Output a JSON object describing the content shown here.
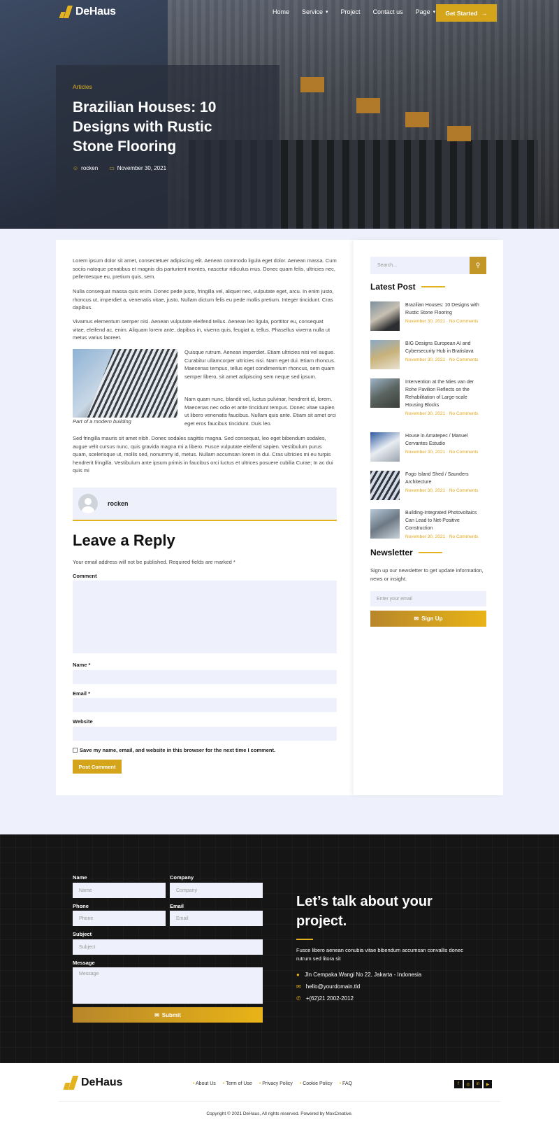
{
  "brand": {
    "name": "DeHaus",
    "accent": "#e2b21f"
  },
  "nav": {
    "items": [
      "Home",
      "Service",
      "Project",
      "Contact us",
      "Page"
    ],
    "cta": "Get Started"
  },
  "hero": {
    "category": "Articles",
    "title": "Brazilian Houses: 10 Designs with Rustic Stone Flooring",
    "author": "rocken",
    "date": "November 30, 2021"
  },
  "article": {
    "p1": "Lorem ipsum dolor sit amet, consectetuer adipiscing elit. Aenean commodo ligula eget dolor. Aenean massa. Cum sociis natoque penatibus et magnis dis parturient montes, nascetur ridiculus mus. Donec quam felis, ultricies nec, pellentesque eu, pretium quis, sem.",
    "p2": "Nulla consequat massa quis enim. Donec pede justo, fringilla vel, aliquet nec, vulputate eget, arcu. In enim justo, rhoncus ut, imperdiet a, venenatis vitae, justo. Nullam dictum felis eu pede mollis pretium. Integer tincidunt. Cras dapibus.",
    "p3": "Vivamus elementum semper nisi. Aenean vulputate eleifend tellus. Aenean leo ligula, porttitor eu, consequat vitae, eleifend ac, enim. Aliquam lorem ante, dapibus in, viverra quis, feugiat a, tellus. Phasellus viverra nulla ut metus varius laoreet.",
    "p4": "Quisque rutrum. Aenean imperdiet. Etiam ultricies nisi vel augue. Curabitur ullamcorper ultricies nisi. Nam eget dui. Etiam rhoncus. Maecenas tempus, tellus eget condimentum rhoncus, sem quam semper libero, sit amet adipiscing sem neque sed ipsum.",
    "p5": "Nam quam nunc, blandit vel, luctus pulvinar, hendrerit id, lorem. Maecenas nec odio et ante tincidunt tempus. Donec vitae sapien ut libero venenatis faucibus. Nullam quis ante. Etiam sit amet orci eget eros faucibus tincidunt. Duis leo.",
    "p6": "Sed fringilla mauris sit amet nibh. Donec sodales sagittis magna. Sed consequat, leo eget bibendum sodales, augue velit cursus nunc, quis gravida magna mi a libero. Fusce vulputate eleifend sapien. Vestibulum purus quam, scelerisque ut, mollis sed, nonummy id, metus. Nullam accumsan lorem in dui. Cras ultricies mi eu turpis hendrerit fringilla. Vestibulum ante ipsum primis in faucibus orci luctus et ultrices posuere cubilia Curae; In ac dui quis mi",
    "caption": "Part of a modern building",
    "author_box": "rocken"
  },
  "reply": {
    "title": "Leave a Reply",
    "note": "Your email address will not be published. Required fields are marked *",
    "comment_label": "Comment",
    "name_label": "Name *",
    "email_label": "Email *",
    "website_label": "Website",
    "save_label": "Save my name, email, and website in this browser for the next time I comment.",
    "submit": "Post Comment"
  },
  "sidebar": {
    "search_placeholder": "Search...",
    "latest_title": "Latest Post",
    "posts": [
      {
        "title": "Brazilian Houses: 10 Designs with Rustic Stone Flooring",
        "meta": "November 30, 2021 · No Comments"
      },
      {
        "title": "BIG Designs European AI and Cybersecurity Hub in Bratislava",
        "meta": "November 30, 2021 · No Comments"
      },
      {
        "title": "Intervention at the Mies van der Rohe Pavilion Reflects on the Rehabilitation of Large-scale Housing Blocks",
        "meta": "November 30, 2021 · No Comments"
      },
      {
        "title": "House in Amatepec / Manuel Cervantes Estudio",
        "meta": "November 30, 2021 · No Comments"
      },
      {
        "title": "Fogo Island Shed / Saunders Architecture",
        "meta": "November 30, 2021 · No Comments"
      },
      {
        "title": "Building-Integrated Photovoltaics Can Lead to Net-Positive Construction",
        "meta": "November 30, 2021 · No Comments"
      }
    ],
    "newsletter_title": "Newsletter",
    "newsletter_text": "Sign up our newsletter to get update information, news or insight.",
    "email_placeholder": "Enter your email",
    "signup": "Sign Up"
  },
  "contact": {
    "name_label": "Name",
    "name_ph": "Name",
    "company_label": "Company",
    "company_ph": "Company",
    "phone_label": "Phone",
    "phone_ph": "Phone",
    "email_label": "Email",
    "email_ph": "Email",
    "subject_label": "Subject",
    "subject_ph": "Subject",
    "message_label": "Message",
    "message_ph": "Message",
    "submit": "Submit",
    "heading": "Let’s talk about your project.",
    "text": "Fusce libero aenean conubia vitae bibendum accumsan convallis donec rutrum sed litora sit",
    "address": "Jln Cempaka Wangi No 22, Jakarta - Indonesia",
    "email": "hello@yourdomain.tld",
    "phone": "+(62)21 2002-2012"
  },
  "footer": {
    "links": [
      "About Us",
      "Term of Use",
      "Privacy Policy",
      "Cookie Policy",
      "FAQ"
    ],
    "social": [
      "facebook-icon",
      "instagram-icon",
      "linkedin-icon",
      "youtube-icon"
    ],
    "copyright": "Copyright © 2021 DeHaus, All rights reserved. Powered by MoxCreative."
  }
}
